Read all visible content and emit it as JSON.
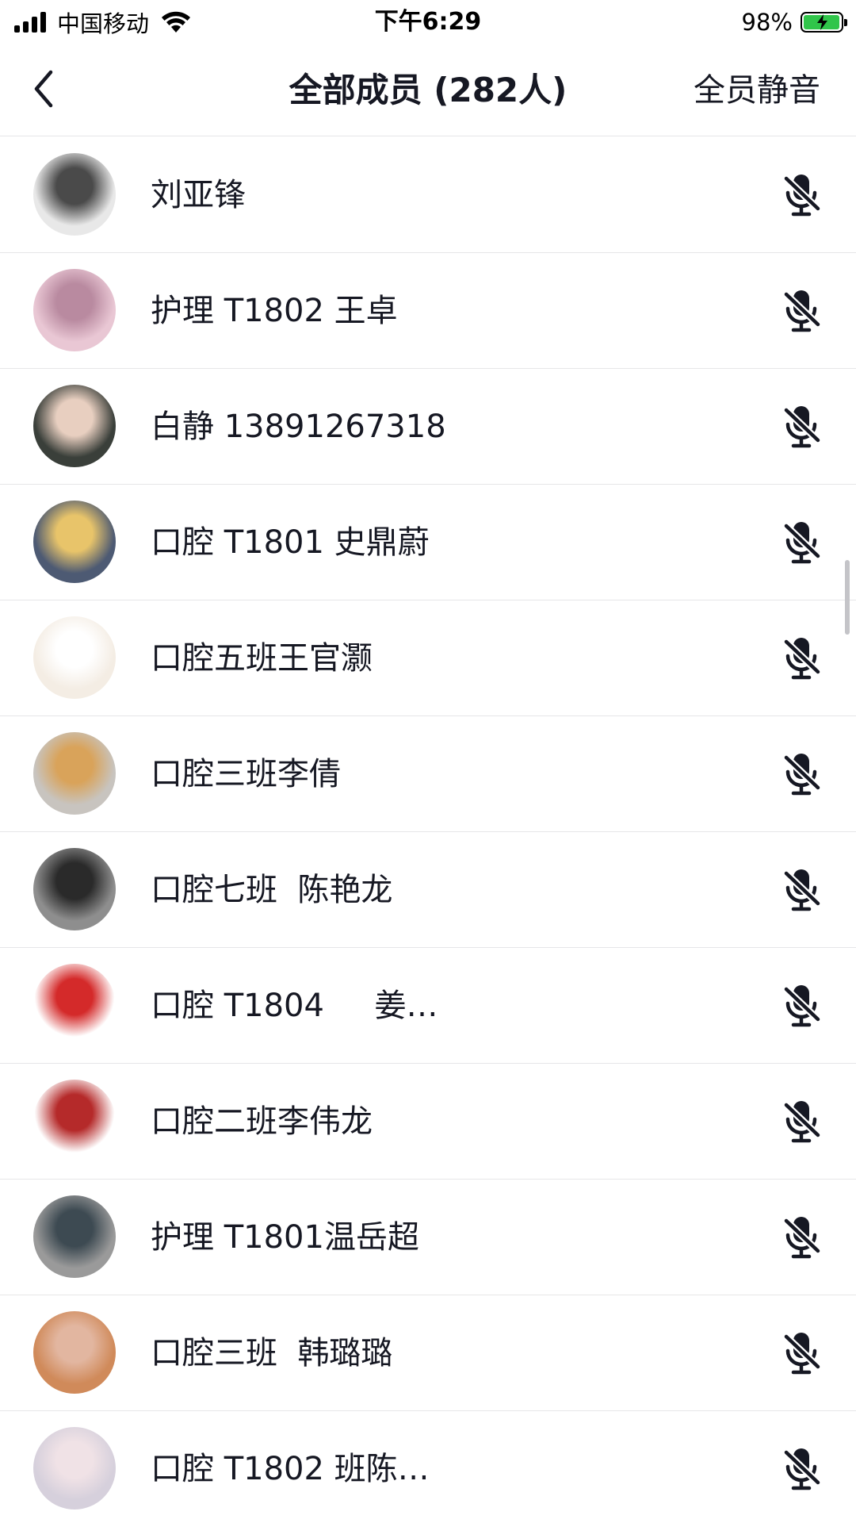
{
  "status_bar": {
    "carrier": "中国移动",
    "time": "下午6:29",
    "battery": "98%",
    "battery_level": 0.98
  },
  "nav": {
    "title": "全部成员 (282人)",
    "action": "全员静音",
    "back_icon": "chevron-left-icon"
  },
  "colors": {
    "text": "#161823",
    "divider": "#e6e6e8",
    "battery_fill": "#30c54a"
  },
  "members": [
    {
      "name": "刘亚锋",
      "avatar_bg": [
        "#e8e8e8",
        "#4a4a4a"
      ]
    },
    {
      "name": "护理 T1802 王卓",
      "avatar_bg": [
        "#e9c7d4",
        "#b98aa0"
      ]
    },
    {
      "name": "白静 13891267318",
      "avatar_bg": [
        "#3a3f3a",
        "#e8cfc0"
      ]
    },
    {
      "name": "口腔 T1801 史鼎蔚",
      "avatar_bg": [
        "#4d5a73",
        "#e8c46a"
      ]
    },
    {
      "name": "口腔五班王官灏",
      "avatar_bg": [
        "#f4ede4",
        "#ffffff"
      ]
    },
    {
      "name": "口腔三班李倩",
      "avatar_bg": [
        "#c8c4bf",
        "#d9a35a"
      ]
    },
    {
      "name": "口腔七班  陈艳龙",
      "avatar_bg": [
        "#8e8e8e",
        "#2a2a2a"
      ]
    },
    {
      "name": "口腔 T1804     姜…",
      "avatar_bg": [
        "#ffffff",
        "#d42a2a"
      ]
    },
    {
      "name": "口腔二班李伟龙",
      "avatar_bg": [
        "#ffffff",
        "#b52a2a"
      ]
    },
    {
      "name": "护理 T1801温岳超",
      "avatar_bg": [
        "#9a9a9a",
        "#3d4a52"
      ]
    },
    {
      "name": "口腔三班  韩璐璐",
      "avatar_bg": [
        "#d08a5a",
        "#e2b6a0"
      ]
    },
    {
      "name": "口腔 T1802 班陈…",
      "avatar_bg": [
        "#d6d0dc",
        "#f0e2e6"
      ]
    }
  ],
  "mute_icon": "microphone-muted-icon"
}
